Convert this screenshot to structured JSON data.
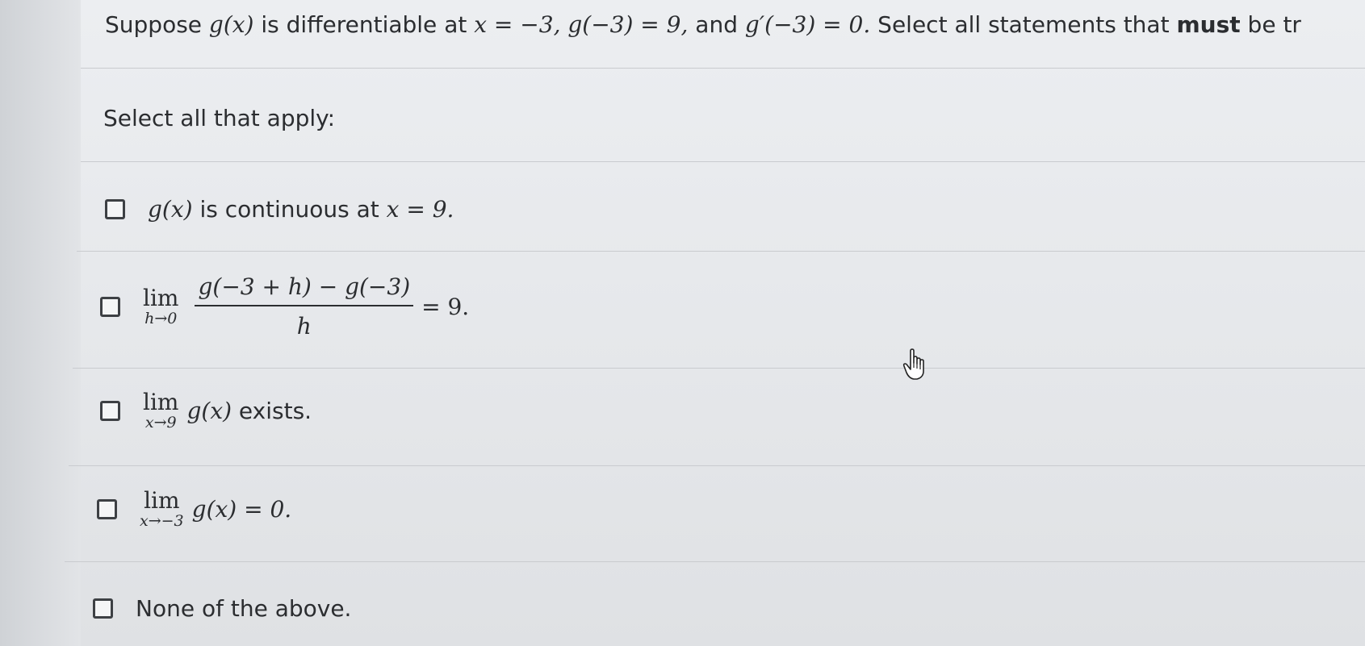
{
  "question": {
    "p1": "Suppose ",
    "m1": "g(x)",
    "p2": " is differentiable at ",
    "m2": "x = −3, g(−3) = 9,",
    "p3": " and ",
    "m3": "g′(−3) = 0.",
    "p4": " Select all statements that ",
    "bold": "must",
    "p5": " be tr"
  },
  "prompt": "Select all that apply:",
  "options": [
    {
      "m1": "g(x)",
      "t1": " is continuous at ",
      "m2": "x = 9."
    },
    {
      "lim": "lim",
      "sub": "h→0",
      "num": "g(−3 + h) − g(−3)",
      "den": "h",
      "tail": "= 9."
    },
    {
      "lim": "lim",
      "sub": "x→9",
      "m1": "g(x)",
      "t1": " exists."
    },
    {
      "lim": "lim",
      "sub": "x→−3",
      "m1": "g(x) = 0."
    },
    {
      "t1": "None of the above."
    }
  ],
  "icons": {
    "checkbox": "checkbox-icon",
    "cursor": "hand-pointer-icon"
  }
}
